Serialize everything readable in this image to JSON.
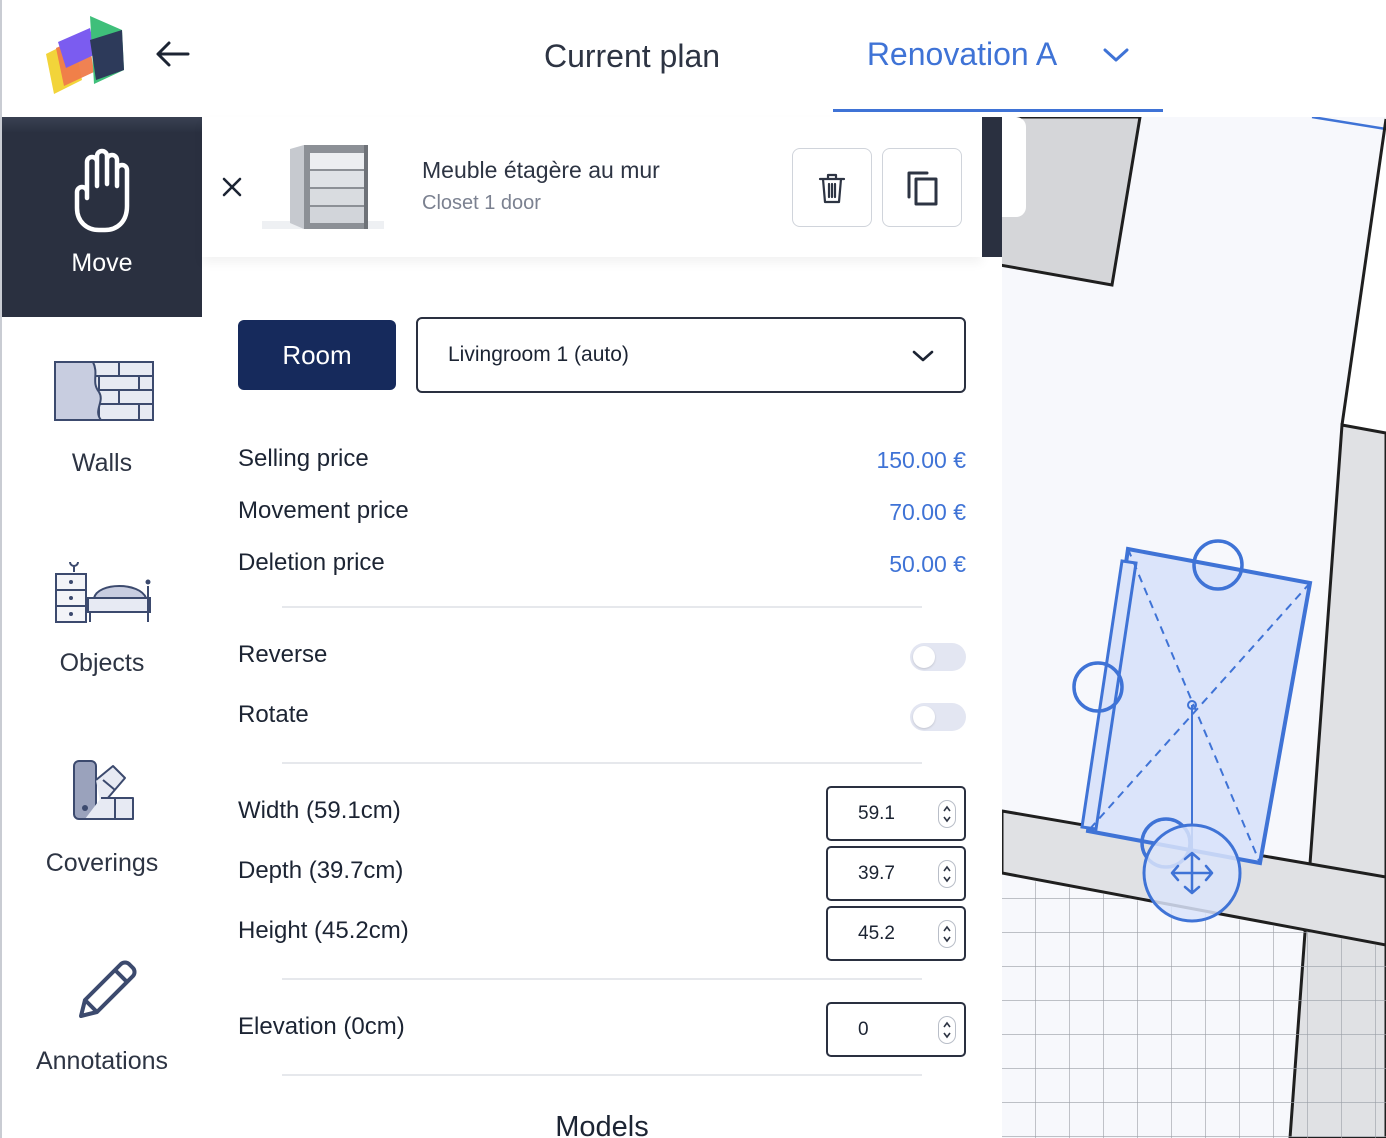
{
  "header": {
    "tabs": [
      {
        "label": "Current plan"
      },
      {
        "label": "Renovation A"
      }
    ]
  },
  "sidebar": {
    "items": [
      {
        "label": "Move"
      },
      {
        "label": "Walls"
      },
      {
        "label": "Objects"
      },
      {
        "label": "Coverings"
      },
      {
        "label": "Annotations"
      }
    ]
  },
  "object": {
    "name": "Meuble étagère au mur",
    "subtitle": "Closet 1 door"
  },
  "room": {
    "button_label": "Room",
    "selected": "Livingroom 1 (auto)"
  },
  "prices": [
    {
      "label": "Selling price",
      "value": "150.00 €"
    },
    {
      "label": "Movement price",
      "value": "70.00 €"
    },
    {
      "label": "Deletion price",
      "value": "50.00 €"
    }
  ],
  "toggles": [
    {
      "label": "Reverse",
      "on": false
    },
    {
      "label": "Rotate",
      "on": false
    }
  ],
  "dimensions": [
    {
      "label": "Width (59.1cm)",
      "value": "59.1"
    },
    {
      "label": "Depth (39.7cm)",
      "value": "39.7"
    },
    {
      "label": "Height (45.2cm)",
      "value": "45.2"
    }
  ],
  "elevation": {
    "label": "Elevation (0cm)",
    "value": "0"
  },
  "models": {
    "title": "Models"
  },
  "colors": {
    "accent": "#3f73d6",
    "dark": "#2a3040",
    "room_button": "#162a5c"
  }
}
